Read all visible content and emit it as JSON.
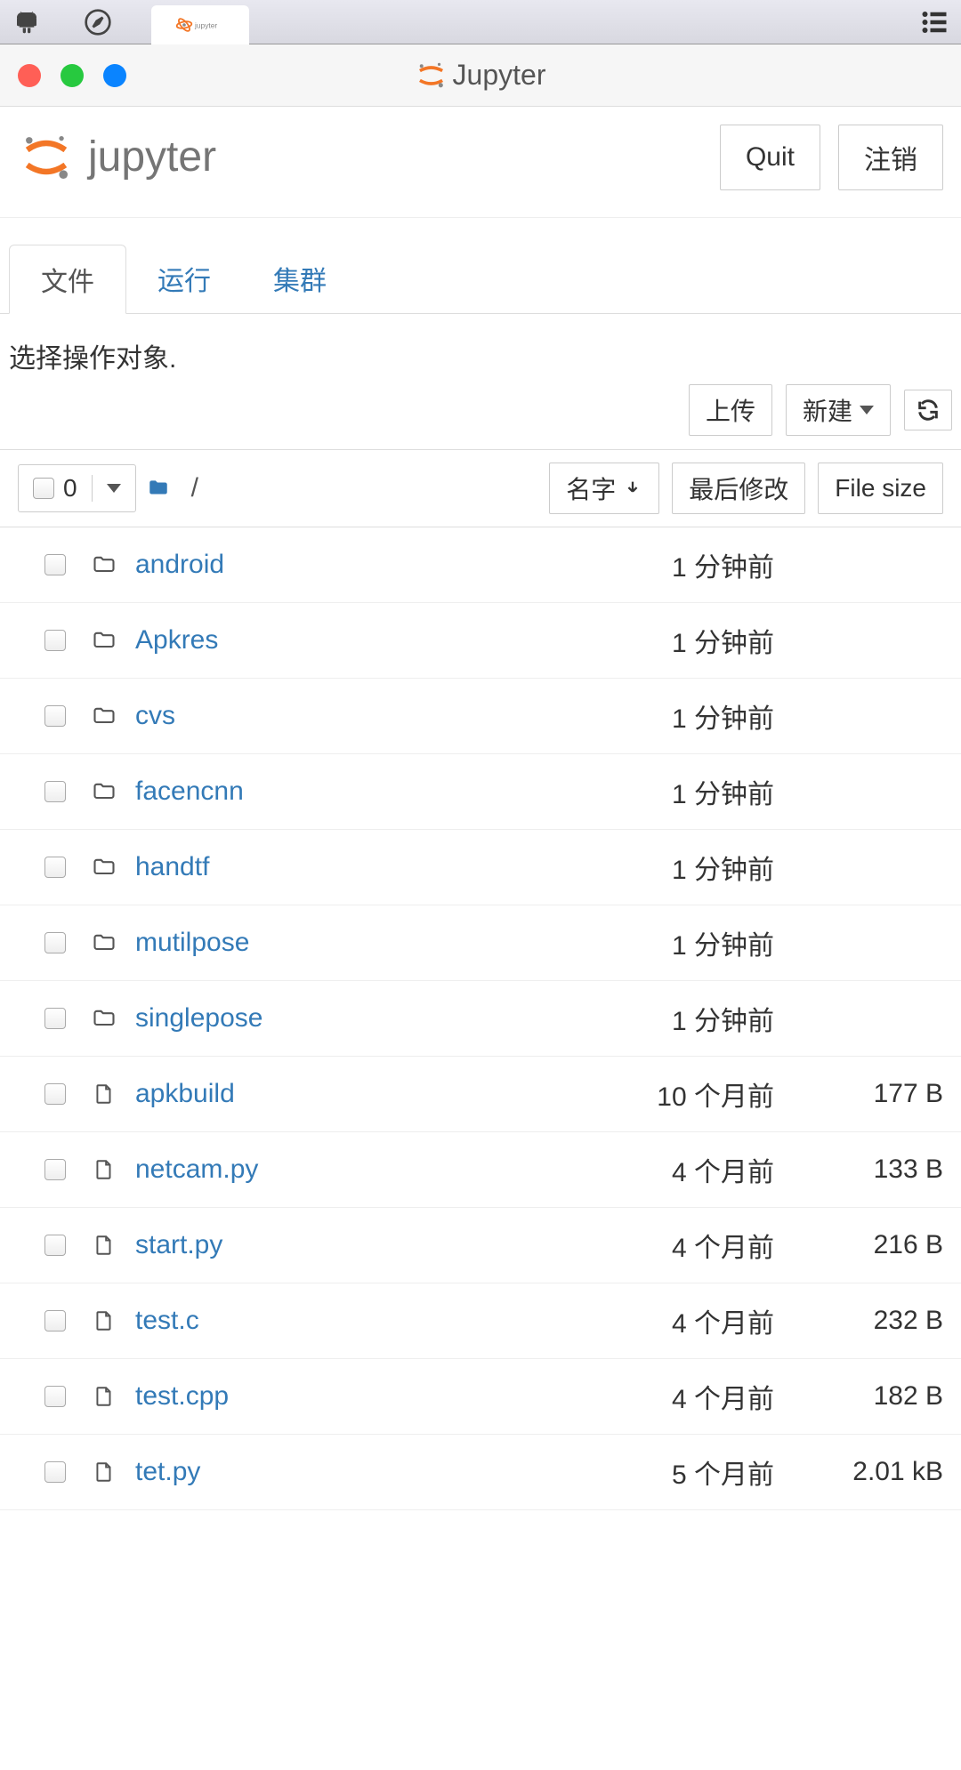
{
  "window": {
    "title": "Jupyter"
  },
  "header": {
    "quit_label": "Quit",
    "logout_label": "注销"
  },
  "tabs": [
    {
      "label": "文件",
      "active": true
    },
    {
      "label": "运行",
      "active": false
    },
    {
      "label": "集群",
      "active": false
    }
  ],
  "instruction": "选择操作对象.",
  "actions": {
    "upload_label": "上传",
    "new_label": "新建"
  },
  "list_header": {
    "selected_count": "0",
    "breadcrumb": "/",
    "sort_name": "名字",
    "sort_modified": "最后修改",
    "sort_size": "File size"
  },
  "files": [
    {
      "type": "folder",
      "name": "android",
      "modified": "1 分钟前",
      "size": ""
    },
    {
      "type": "folder",
      "name": "Apkres",
      "modified": "1 分钟前",
      "size": ""
    },
    {
      "type": "folder",
      "name": "cvs",
      "modified": "1 分钟前",
      "size": ""
    },
    {
      "type": "folder",
      "name": "facencnn",
      "modified": "1 分钟前",
      "size": ""
    },
    {
      "type": "folder",
      "name": "handtf",
      "modified": "1 分钟前",
      "size": ""
    },
    {
      "type": "folder",
      "name": "mutilpose",
      "modified": "1 分钟前",
      "size": ""
    },
    {
      "type": "folder",
      "name": "singlepose",
      "modified": "1 分钟前",
      "size": ""
    },
    {
      "type": "file",
      "name": "apkbuild",
      "modified": "10 个月前",
      "size": "177 B"
    },
    {
      "type": "file",
      "name": "netcam.py",
      "modified": "4 个月前",
      "size": "133 B"
    },
    {
      "type": "file",
      "name": "start.py",
      "modified": "4 个月前",
      "size": "216 B"
    },
    {
      "type": "file",
      "name": "test.c",
      "modified": "4 个月前",
      "size": "232 B"
    },
    {
      "type": "file",
      "name": "test.cpp",
      "modified": "4 个月前",
      "size": "182 B"
    },
    {
      "type": "file",
      "name": "tet.py",
      "modified": "5 个月前",
      "size": "2.01 kB"
    }
  ]
}
